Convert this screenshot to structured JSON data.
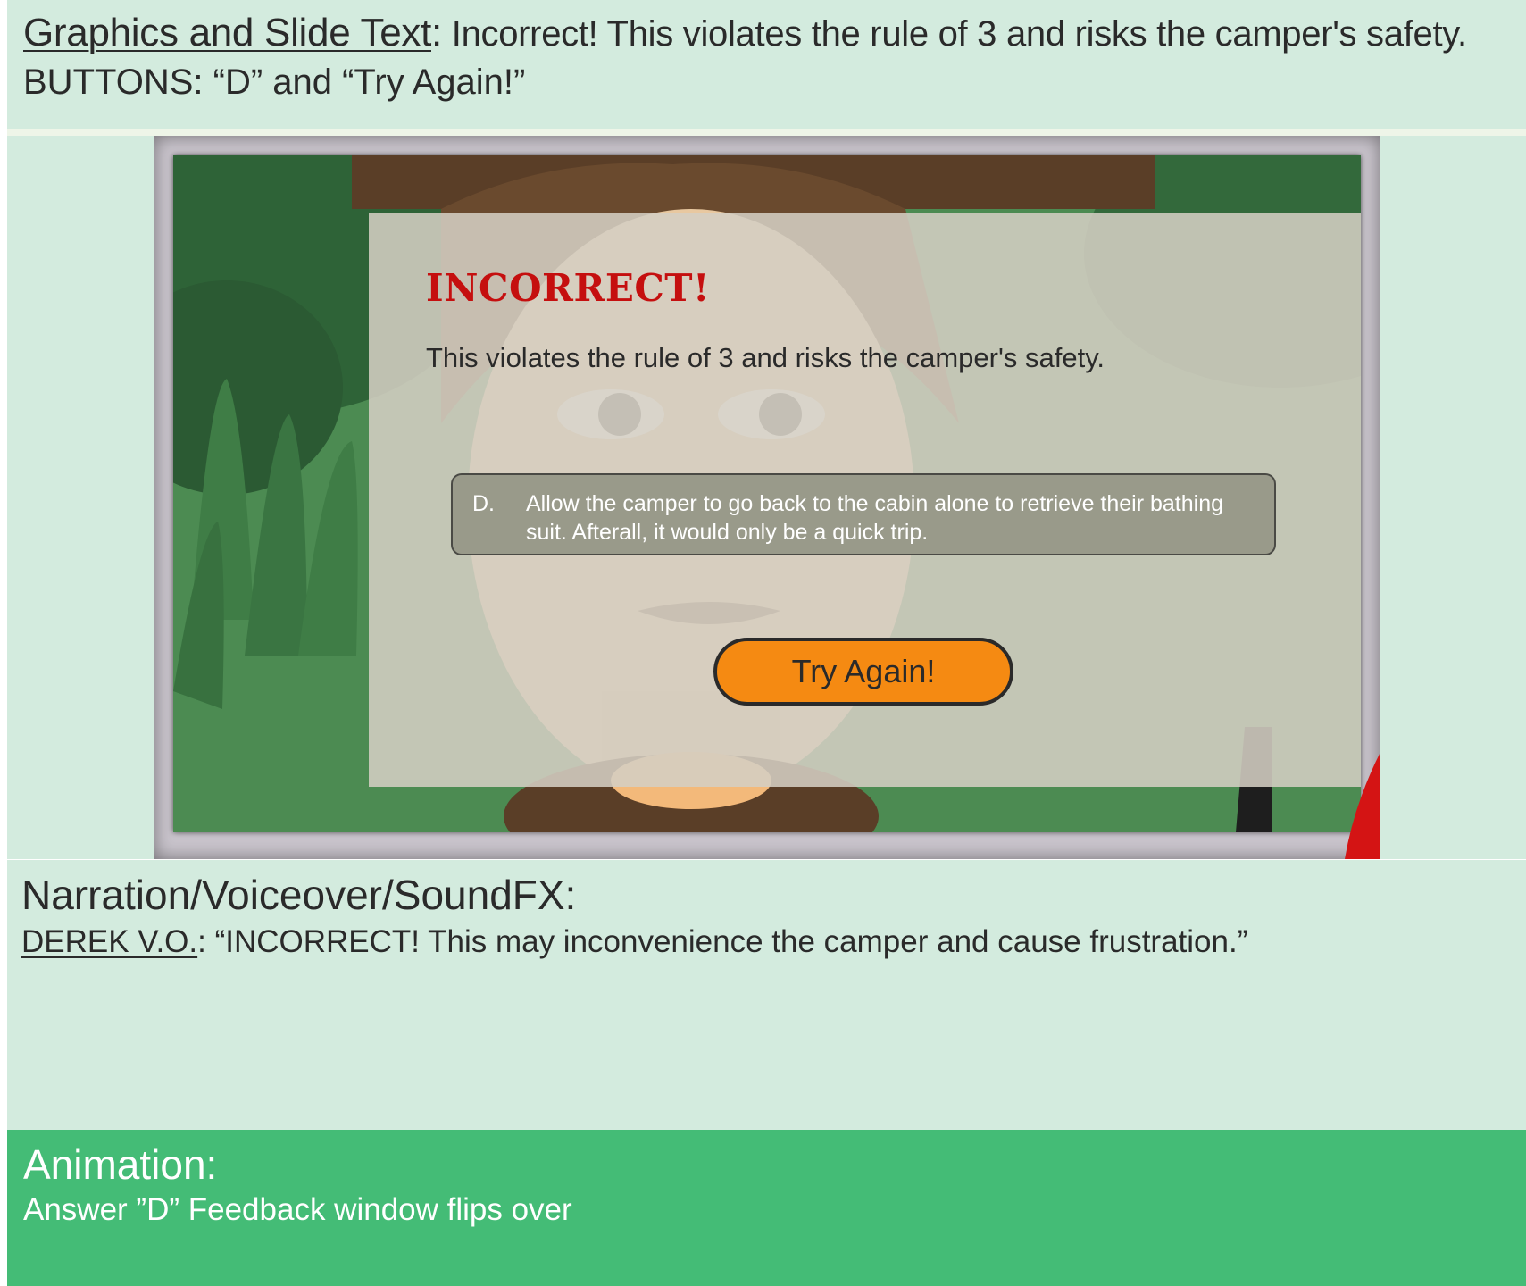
{
  "header": {
    "label": "Graphics and Slide Text",
    "separator": ":",
    "text": " Incorrect! This violates the rule of 3 and risks the camper's safety.",
    "buttons_line": "BUTTONS: “D” and “Try Again!”"
  },
  "slide": {
    "title": "INCORRECT!",
    "message": "This violates the rule of 3 and risks the camper's safety.",
    "choice": {
      "letter": "D.",
      "text": "Allow the camper to go back to the cabin alone to retrieve  their bathing suit. Afterall, it would only be a quick trip."
    },
    "button_label": "Try Again!",
    "colors": {
      "title": "#c50f0f",
      "button": "#f58a12",
      "panel": "#d4cec3"
    }
  },
  "narration": {
    "heading": "Narration/Voiceover/SoundFX:",
    "speaker": "DEREK V.O.",
    "separator": ":",
    "line": " “INCORRECT! This may inconvenience the camper and cause frustration.”"
  },
  "animation": {
    "heading": "Animation:",
    "text": "Answer ”D” Feedback window flips over",
    "color": "#44bc76"
  }
}
